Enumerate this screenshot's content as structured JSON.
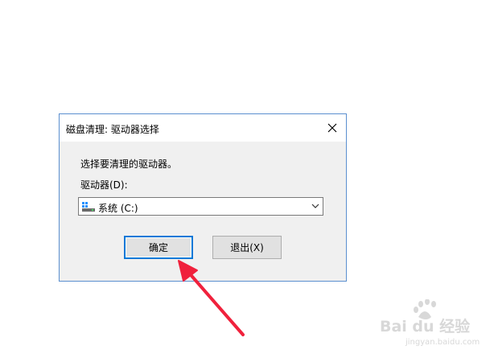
{
  "dialog": {
    "title": "磁盘清理: 驱动器选择",
    "prompt": "选择要清理的驱动器。",
    "drive_label": "驱动器(D):",
    "selected_drive": "系统 (C:)",
    "ok_label": "确定",
    "cancel_label": "退出(X)"
  },
  "icons": {
    "close": "close-icon",
    "drive": "hard-drive-icon",
    "dropdown": "chevron-down-icon"
  },
  "annotation": {
    "arrow_color": "#f0213c"
  },
  "watermark": {
    "text": "Bai du 经验",
    "subtext": "jingyan.baidu.com"
  },
  "colors": {
    "accent": "#0078d7",
    "window_border": "#5b8fcf",
    "dialog_bg": "#f0f0f0"
  }
}
